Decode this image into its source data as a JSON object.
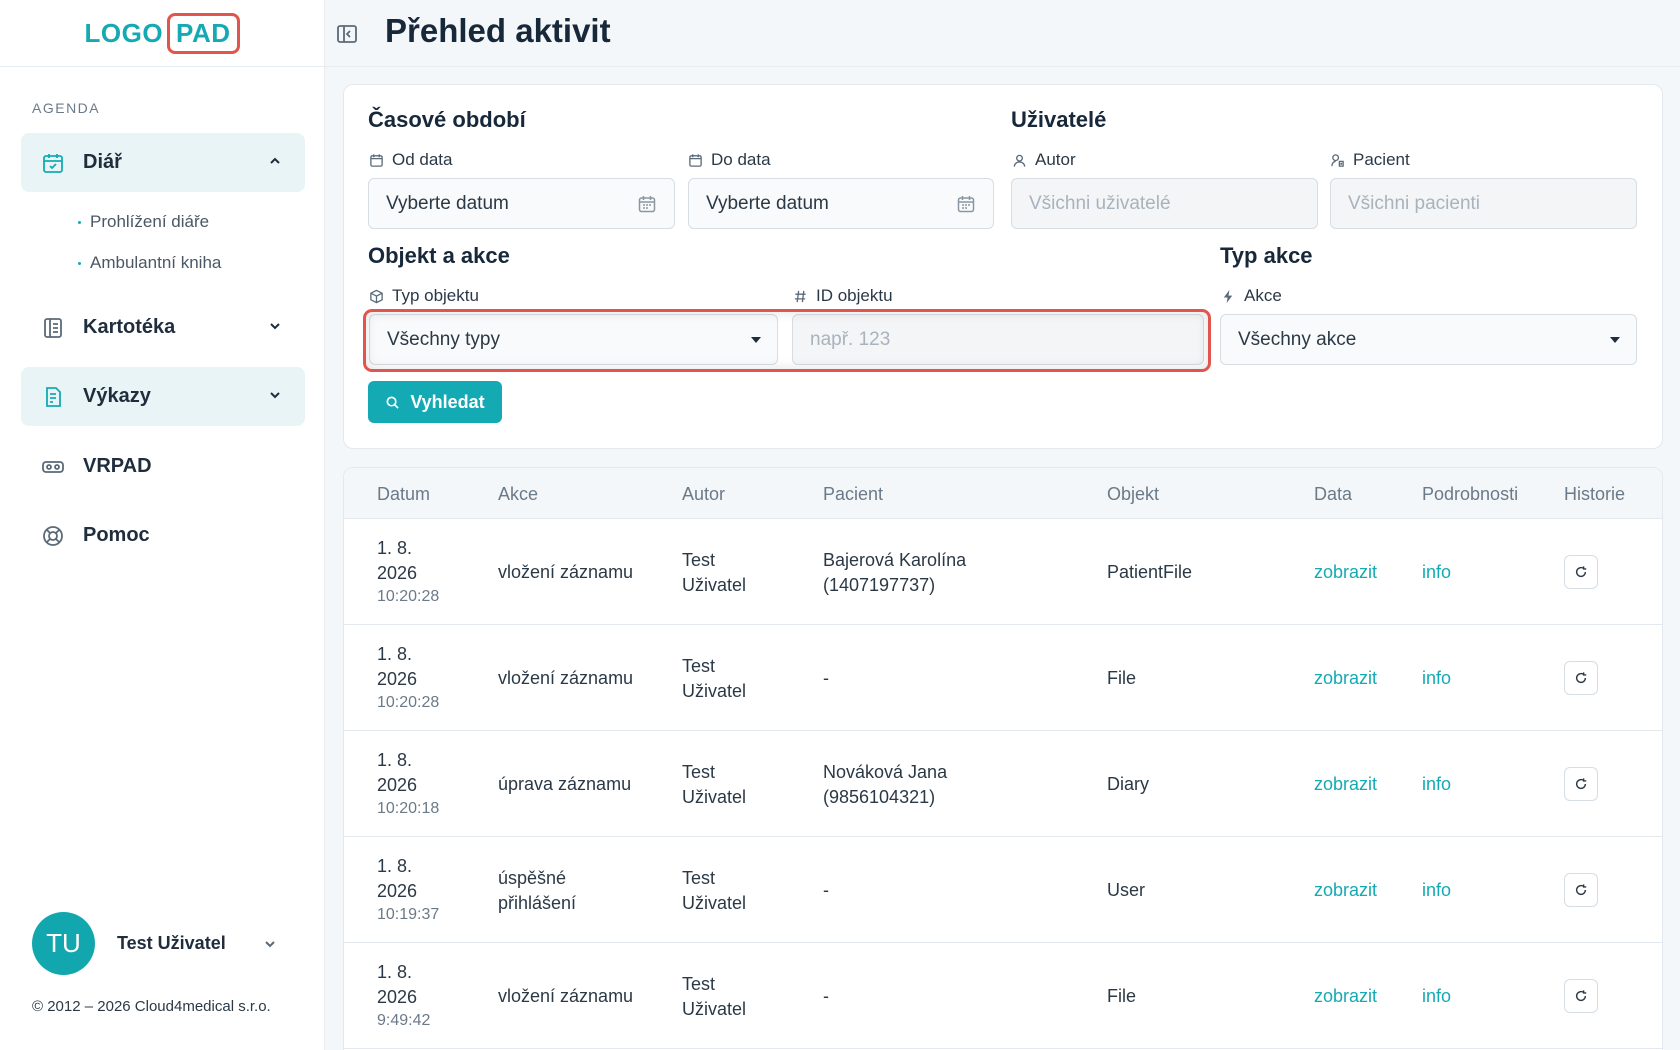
{
  "brand": {
    "logo_left": "LOGO",
    "logo_right": "PAD"
  },
  "sidebar": {
    "section_label": "AGENDA",
    "items": [
      {
        "label": "Diář",
        "icon": "calendar-check-icon"
      },
      {
        "label": "Kartotéka",
        "icon": "book-icon"
      },
      {
        "label": "Výkazy",
        "icon": "report-icon"
      },
      {
        "label": "VRPAD",
        "icon": "vr-headset-icon"
      },
      {
        "label": "Pomoc",
        "icon": "lifebuoy-icon"
      }
    ],
    "sub_items": [
      "Prohlížení diáře",
      "Ambulantní kniha"
    ],
    "user": {
      "initials": "TU",
      "name": "Test Uživatel"
    },
    "copyright": "© 2012 – 2026 Cloud4medical s.r.o."
  },
  "header": {
    "title": "Přehled aktivit"
  },
  "filters": {
    "period_title": "Časové období",
    "users_title": "Uživatelé",
    "object_title": "Objekt a akce",
    "action_type_title": "Typ akce",
    "from_label": "Od data",
    "from_value": "Vyberte datum",
    "to_label": "Do data",
    "to_value": "Vyberte datum",
    "author_label": "Autor",
    "author_placeholder": "Všichni uživatelé",
    "patient_label": "Pacient",
    "patient_placeholder": "Všichni pacienti",
    "object_type_label": "Typ objektu",
    "object_type_value": "Všechny typy",
    "object_id_label": "ID objektu",
    "object_id_placeholder": "např. 123",
    "action_label": "Akce",
    "action_value": "Všechny akce",
    "search_button": "Vyhledat"
  },
  "table": {
    "headers": [
      "Datum",
      "Akce",
      "Autor",
      "Pacient",
      "Objekt",
      "Data",
      "Podrobnosti",
      "Historie"
    ],
    "rows": [
      {
        "date1": "1. 8.",
        "date2": "2026",
        "time": "10:20:28",
        "action1": "vložení záznamu",
        "action2": "",
        "author1": "Test",
        "author2": "Uživatel",
        "patient1": "Bajerová Karolína",
        "patient2": "(1407197737)",
        "object": "PatientFile",
        "data": "zobrazit",
        "details": "info"
      },
      {
        "date1": "1. 8.",
        "date2": "2026",
        "time": "10:20:28",
        "action1": "vložení záznamu",
        "action2": "",
        "author1": "Test",
        "author2": "Uživatel",
        "patient1": "-",
        "patient2": "",
        "object": "File",
        "data": "zobrazit",
        "details": "info"
      },
      {
        "date1": "1. 8.",
        "date2": "2026",
        "time": "10:20:18",
        "action1": "úprava záznamu",
        "action2": "",
        "author1": "Test",
        "author2": "Uživatel",
        "patient1": "Nováková Jana",
        "patient2": "(9856104321)",
        "object": "Diary",
        "data": "zobrazit",
        "details": "info"
      },
      {
        "date1": "1. 8.",
        "date2": "2026",
        "time": "10:19:37",
        "action1": "úspěšné",
        "action2": "přihlášení",
        "author1": "Test",
        "author2": "Uživatel",
        "patient1": "-",
        "patient2": "",
        "object": "User",
        "data": "zobrazit",
        "details": "info"
      },
      {
        "date1": "1. 8.",
        "date2": "2026",
        "time": "9:49:42",
        "action1": "vložení záznamu",
        "action2": "",
        "author1": "Test",
        "author2": "Uživatel",
        "patient1": "-",
        "patient2": "",
        "object": "File",
        "data": "zobrazit",
        "details": "info"
      }
    ]
  },
  "colors": {
    "accent": "#14aab4",
    "highlight": "#e2544e",
    "text": "#17283a"
  }
}
